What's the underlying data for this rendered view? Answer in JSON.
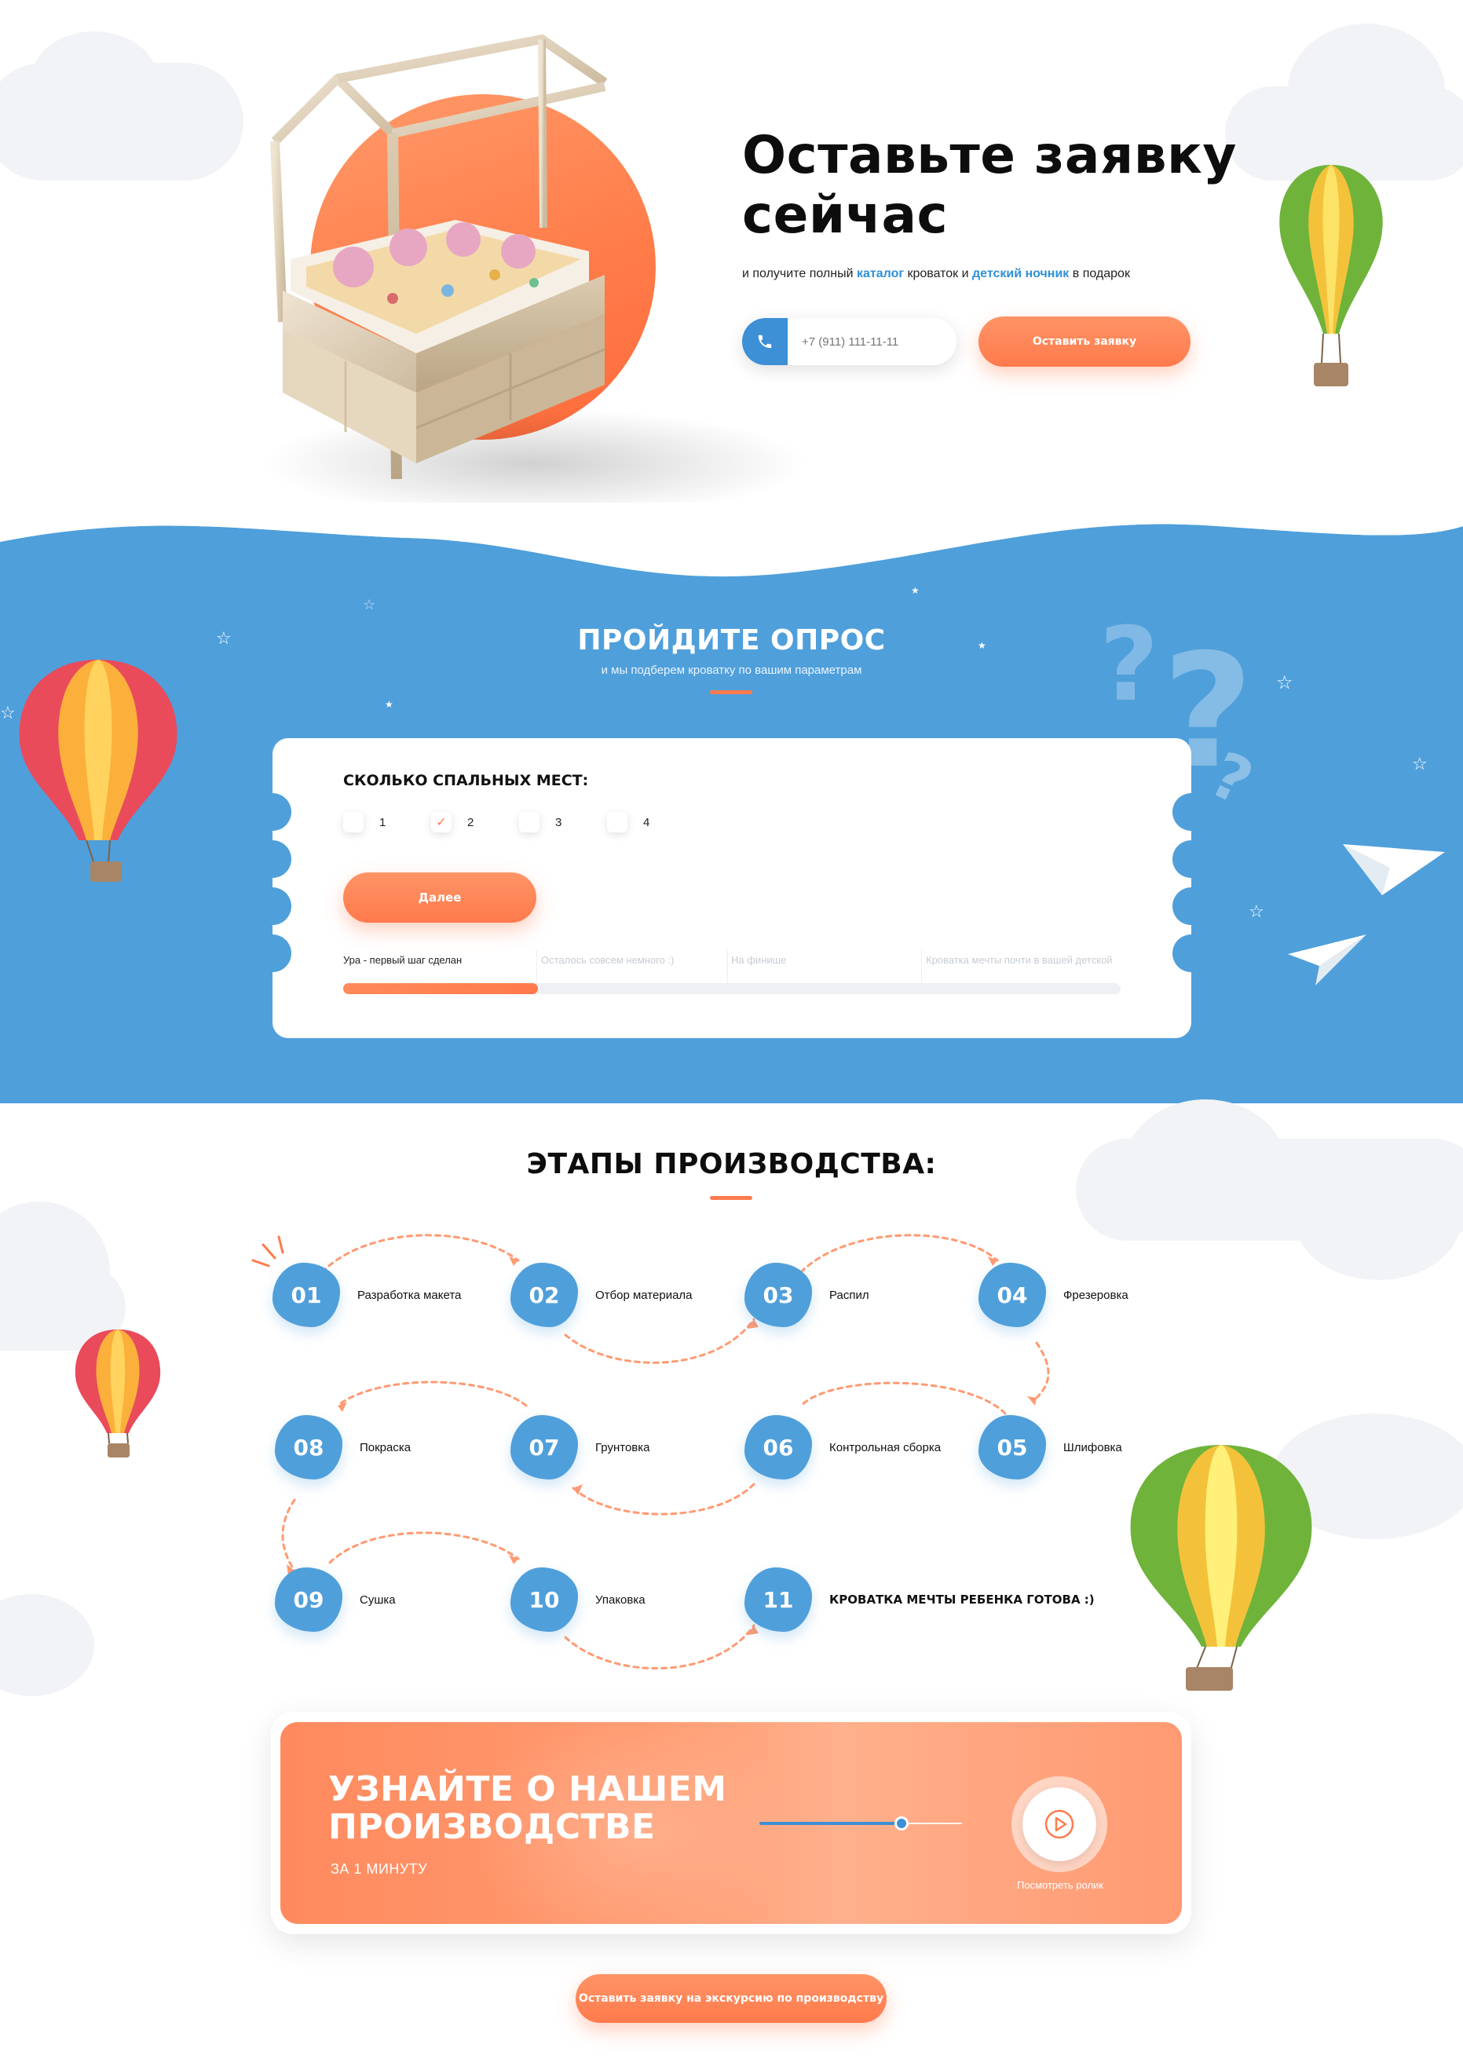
{
  "hero": {
    "title_line1": "Оставьте заявку",
    "title_line2": "сейчас",
    "subtitle_pre": "и получите полный ",
    "subtitle_link1": "каталог",
    "subtitle_mid": " кроваток и ",
    "subtitle_link2": "детский ночник",
    "subtitle_post": " в подарок",
    "phone_placeholder": "+7 (911) 111-11-11",
    "submit_label": "Оставить заявку"
  },
  "quiz": {
    "title": "ПРОЙДИТЕ ОПРОС",
    "subtitle": "и мы подберем кроватку по вашим параметрам",
    "question": "СКОЛЬКО СПАЛЬНЫХ МЕСТ:",
    "options": [
      {
        "label": "1",
        "checked": false
      },
      {
        "label": "2",
        "checked": true
      },
      {
        "label": "3",
        "checked": false
      },
      {
        "label": "4",
        "checked": false
      }
    ],
    "next_label": "Далее",
    "progress_steps": [
      "Ура - первый шаг сделан",
      "Осталось совсем немного :)",
      "На финише",
      "Кроватка мечты почти в вашей детской"
    ],
    "progress_fraction": 0.25
  },
  "stages": {
    "title": "ЭТАПЫ ПРОИЗВОДСТВА:",
    "steps": [
      {
        "num": "01",
        "label": "Разработка макета"
      },
      {
        "num": "02",
        "label": "Отбор материала"
      },
      {
        "num": "03",
        "label": "Распил"
      },
      {
        "num": "04",
        "label": "Фрезеровка"
      },
      {
        "num": "05",
        "label": "Шлифовка"
      },
      {
        "num": "06",
        "label": "Контрольная сборка"
      },
      {
        "num": "07",
        "label": "Грунтовка"
      },
      {
        "num": "08",
        "label": "Покраска"
      },
      {
        "num": "09",
        "label": "Сушка"
      },
      {
        "num": "10",
        "label": "Упаковка"
      },
      {
        "num": "11",
        "label": "КРОВАТКА МЕЧТЫ РЕБЕНКА ГОТОВА :)"
      }
    ]
  },
  "video": {
    "title_line1": "УЗНАЙТЕ О НАШЕМ",
    "title_line2": "ПРОИЗВОДСТВЕ",
    "subtitle": "ЗА 1 МИНУТУ",
    "play_caption": "Посмотреть ролик",
    "progress_fraction": 0.7
  },
  "cta": {
    "label": "Оставить заявку на экскурсию по производству"
  },
  "colors": {
    "accent_orange": "#ff7a4c",
    "accent_blue": "#4f9fdb",
    "link_blue": "#2e90d8"
  }
}
